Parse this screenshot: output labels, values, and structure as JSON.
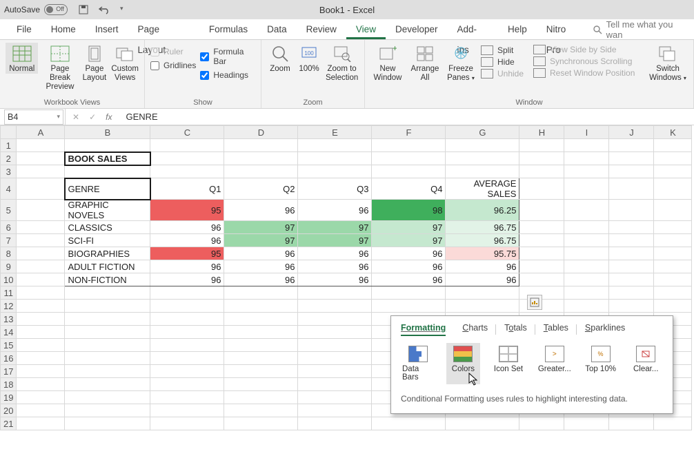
{
  "titlebar": {
    "autosave_label": "AutoSave",
    "autosave_state": "Off",
    "title": "Book1 - Excel"
  },
  "tabs": [
    "File",
    "Home",
    "Insert",
    "Page Layout",
    "Formulas",
    "Data",
    "Review",
    "View",
    "Developer",
    "Add-ins",
    "Help",
    "Nitro Pro"
  ],
  "active_tab": "View",
  "tell_me": "Tell me what you wan",
  "ribbon": {
    "views": {
      "normal": "Normal",
      "page_break": "Page Break Preview",
      "page_layout": "Page Layout",
      "custom": "Custom Views",
      "group": "Workbook Views"
    },
    "show": {
      "ruler": "Ruler",
      "formula_bar": "Formula Bar",
      "gridlines": "Gridlines",
      "headings": "Headings",
      "group": "Show"
    },
    "zoom": {
      "zoom": "Zoom",
      "hundred": "100%",
      "zoom_sel": "Zoom to Selection",
      "group": "Zoom"
    },
    "window": {
      "new_window": "New Window",
      "arrange": "Arrange All",
      "freeze": "Freeze Panes",
      "split": "Split",
      "hide": "Hide",
      "unhide": "Unhide",
      "side_by_side": "View Side by Side",
      "sync_scroll": "Synchronous Scrolling",
      "reset_pos": "Reset Window Position",
      "switch": "Switch Windows",
      "group": "Window"
    }
  },
  "namebox": "B4",
  "formula": "GENRE",
  "columns": [
    "A",
    "B",
    "C",
    "D",
    "E",
    "F",
    "G",
    "H",
    "I",
    "J",
    "K"
  ],
  "row_numbers": [
    1,
    2,
    3,
    4,
    5,
    6,
    7,
    8,
    9,
    10,
    11,
    12,
    13,
    14,
    15,
    16,
    17,
    18,
    19,
    20,
    21
  ],
  "sheet": {
    "title": "BOOK SALES",
    "headers": [
      "GENRE",
      "Q1",
      "Q2",
      "Q3",
      "Q4",
      "AVERAGE SALES"
    ],
    "rows": [
      {
        "genre": "GRAPHIC NOVELS",
        "q": [
          95,
          96,
          96,
          98
        ],
        "avg": "96.25",
        "fills": [
          "red",
          "",
          "",
          "greenDk",
          "greenLt"
        ]
      },
      {
        "genre": "CLASSICS",
        "q": [
          96,
          97,
          97,
          97
        ],
        "avg": "96.75",
        "fills": [
          "",
          "greenMd",
          "greenMd",
          "greenLt",
          "greenXl"
        ]
      },
      {
        "genre": "SCI-FI",
        "q": [
          96,
          97,
          97,
          97
        ],
        "avg": "96.75",
        "fills": [
          "",
          "greenMd",
          "greenMd",
          "greenLt",
          "greenXl"
        ]
      },
      {
        "genre": "BIOGRAPHIES",
        "q": [
          95,
          96,
          96,
          96
        ],
        "avg": "95.75",
        "fills": [
          "red",
          "",
          "",
          "",
          "pink"
        ]
      },
      {
        "genre": "ADULT FICTION",
        "q": [
          96,
          96,
          96,
          96
        ],
        "avg": "96",
        "fills": [
          "",
          "",
          "",
          "",
          ""
        ]
      },
      {
        "genre": "NON-FICTION",
        "q": [
          96,
          96,
          96,
          96
        ],
        "avg": "96",
        "fills": [
          "",
          "",
          "",
          "",
          ""
        ]
      }
    ]
  },
  "qa": {
    "tabs": [
      "Formatting",
      "Charts",
      "Totals",
      "Tables",
      "Sparklines"
    ],
    "active": "Formatting",
    "items": [
      "Data Bars",
      "Colors",
      "Icon Set",
      "Greater...",
      "Top 10%",
      "Clear..."
    ],
    "selected": "Colors",
    "desc": "Conditional Formatting uses rules to highlight interesting data."
  },
  "chart_data": {
    "type": "table",
    "title": "BOOK SALES",
    "columns": [
      "GENRE",
      "Q1",
      "Q2",
      "Q3",
      "Q4",
      "AVERAGE SALES"
    ],
    "rows": [
      [
        "GRAPHIC NOVELS",
        95,
        96,
        96,
        98,
        96.25
      ],
      [
        "CLASSICS",
        96,
        97,
        97,
        97,
        96.75
      ],
      [
        "SCI-FI",
        96,
        97,
        97,
        97,
        96.75
      ],
      [
        "BIOGRAPHIES",
        95,
        96,
        96,
        96,
        95.75
      ],
      [
        "ADULT FICTION",
        96,
        96,
        96,
        96,
        96
      ],
      [
        "NON-FICTION",
        96,
        96,
        96,
        96,
        96
      ]
    ]
  }
}
